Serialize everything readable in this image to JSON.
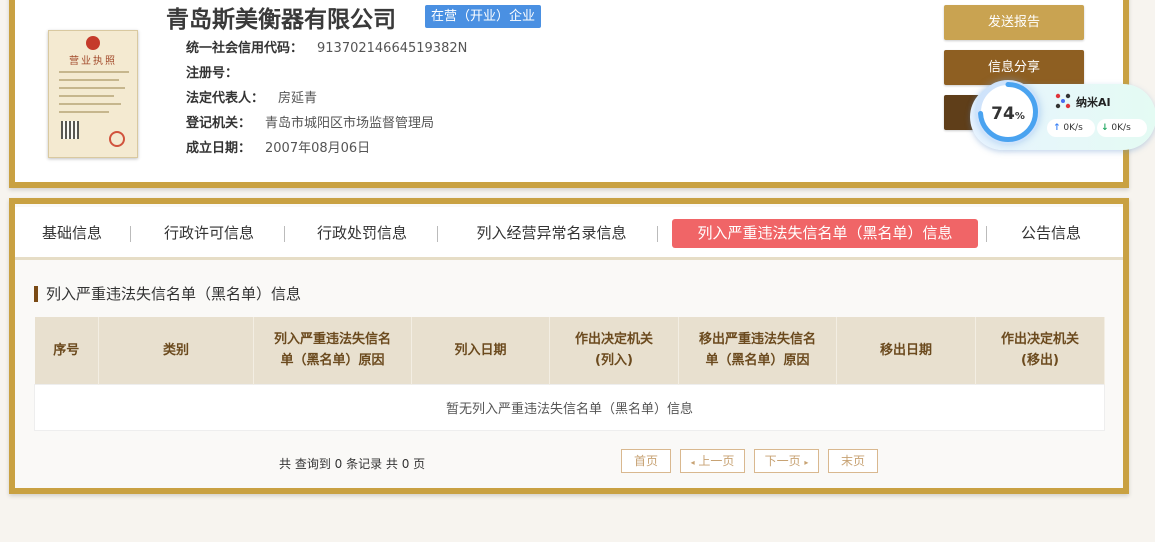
{
  "company": {
    "name": "青岛斯美衡器有限公司",
    "status": "在营（开业）企业",
    "fields": [
      {
        "label": "统一社会信用代码：",
        "value": "91370214664519382N"
      },
      {
        "label": "注册号：",
        "value": ""
      },
      {
        "label": "法定代表人：",
        "value": "房延青"
      },
      {
        "label": "登记机关：",
        "value": "青岛市城阳区市场监督管理局"
      },
      {
        "label": "成立日期：",
        "value": "2007年08月06日"
      }
    ]
  },
  "license": {
    "title": "营业执照"
  },
  "actions": {
    "report": "发送报告",
    "share": "信息分享"
  },
  "ai_widget": {
    "percent": 74,
    "percent_unit": "%",
    "name": "纳米AI",
    "upload": "0K/s",
    "download": "0K/s"
  },
  "tabs": [
    {
      "label": "基础信息",
      "active": false
    },
    {
      "label": "行政许可信息",
      "active": false
    },
    {
      "label": "行政处罚信息",
      "active": false
    },
    {
      "label": "列入经营异常名录信息",
      "active": false
    },
    {
      "label": "列入严重违法失信名单（黑名单）信息",
      "active": true
    },
    {
      "label": "公告信息",
      "active": false
    }
  ],
  "section": {
    "title": "列入严重违法失信名单（黑名单）信息"
  },
  "table": {
    "headers": [
      {
        "line1": "序号",
        "line2": ""
      },
      {
        "line1": "类别",
        "line2": ""
      },
      {
        "line1": "列入严重违法失信名",
        "line2": "单（黑名单）原因"
      },
      {
        "line1": "列入日期",
        "line2": ""
      },
      {
        "line1": "作出决定机关",
        "line2": "(列入)"
      },
      {
        "line1": "移出严重违法失信名",
        "line2": "单（黑名单）原因"
      },
      {
        "line1": "移出日期",
        "line2": ""
      },
      {
        "line1": "作出决定机关",
        "line2": "(移出)"
      }
    ],
    "empty_message": "暂无列入严重违法失信名单（黑名单）信息"
  },
  "pagination": {
    "summary": "共 查询到 0 条记录 共 0 页",
    "first": "首页",
    "prev": "上一页",
    "next": "下一页",
    "last": "末页"
  }
}
